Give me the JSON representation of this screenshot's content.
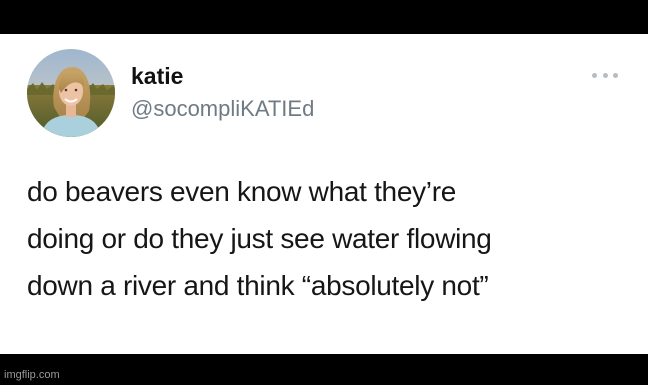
{
  "tweet": {
    "author": {
      "display_name": "katie",
      "handle": "@socompliKATIEd",
      "avatar_icon": "profile-photo"
    },
    "more_icon": "more-horizontal-icon",
    "text_lines": [
      "do beavers even know what they’re",
      "doing or do they just see water flowing",
      "down a river and think “absolutely not”"
    ]
  },
  "watermark": "imgflip.com",
  "colors": {
    "background": "#000000",
    "card": "#ffffff",
    "name": "#111111",
    "handle": "#6f7a84",
    "text": "#161616"
  }
}
